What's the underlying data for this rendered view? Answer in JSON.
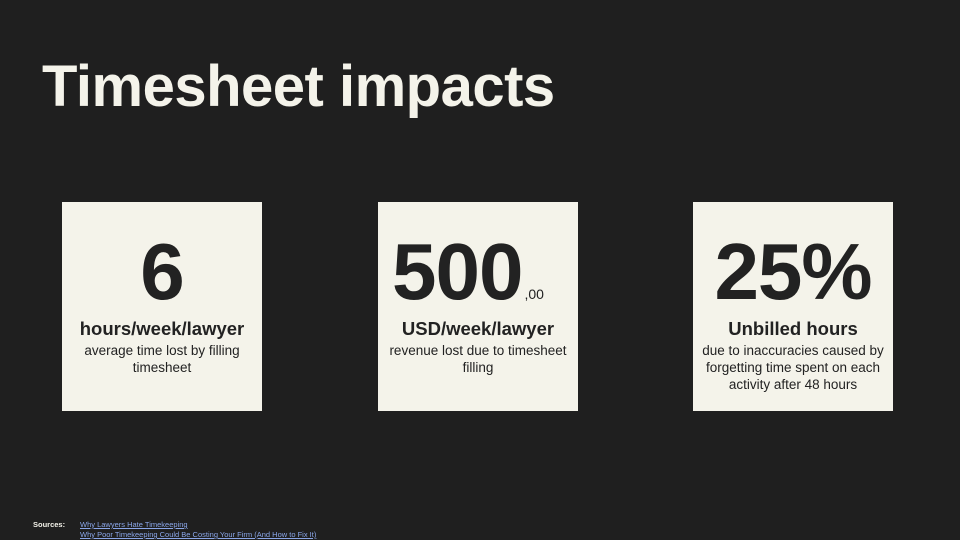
{
  "title": "Timesheet impacts",
  "cards": [
    {
      "value": "6",
      "value_suffix": "",
      "headline": "hours/week/lawyer",
      "description": "average time lost by filling timesheet"
    },
    {
      "value": "500",
      "value_suffix": ",00",
      "headline": "USD/week/lawyer",
      "description": "revenue lost due to timesheet filling"
    },
    {
      "value": "25%",
      "value_suffix": "",
      "headline": "Unbilled hours",
      "description": "due to inaccuracies caused by forgetting time spent on each activity after 48 hours"
    }
  ],
  "sources": {
    "label": "Sources:",
    "links": [
      "Why Lawyers Hate Timekeeping",
      "Why Poor Timekeeping Could Be Costing Your Firm (And How to Fix It)"
    ]
  },
  "colors": {
    "background": "#1f1f1f",
    "card": "#f4f3ea",
    "text_dark": "#222222",
    "link": "#8aa6e8"
  }
}
